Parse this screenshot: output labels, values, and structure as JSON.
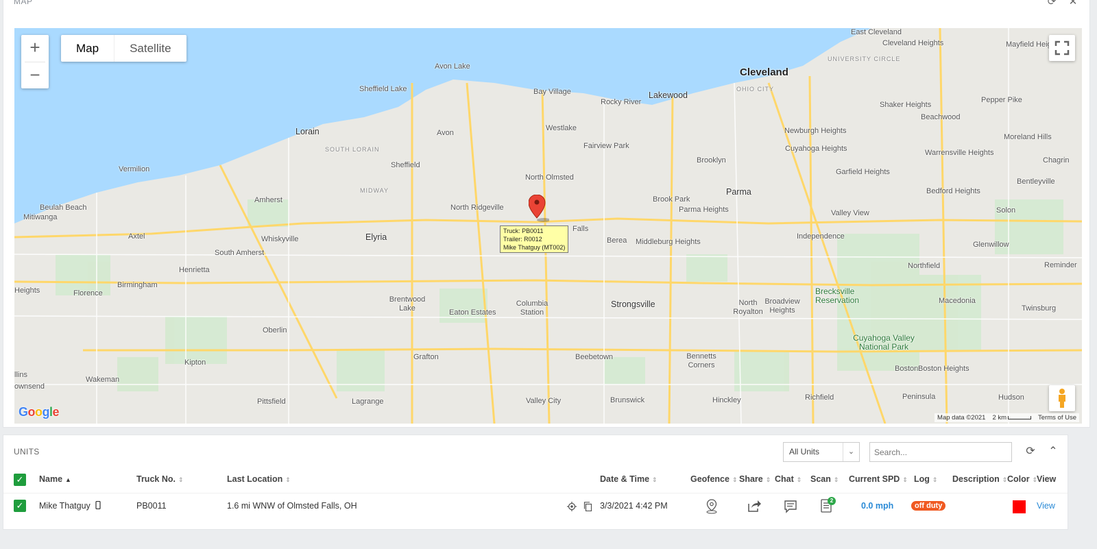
{
  "map_panel": {
    "title": "MAP",
    "refresh_icon": "refresh-icon",
    "close_icon": "close-icon",
    "controls": {
      "zoom_in": "+",
      "zoom_out": "−",
      "map_types": [
        "Map",
        "Satellite"
      ],
      "active_map_type": "Map"
    },
    "logo": "Google",
    "attribution": {
      "map_data": "Map data ©2021",
      "scale": "2 km",
      "terms": "Terms of Use"
    },
    "places": [
      {
        "name": "Cleveland",
        "size": "big"
      },
      {
        "name": "East Cleveland"
      },
      {
        "name": "Cleveland Heights"
      },
      {
        "name": "Mayfield Heights"
      },
      {
        "name": "UNIVERSITY CIRCLE",
        "size": "district"
      },
      {
        "name": "OHIO CITY",
        "size": "district"
      },
      {
        "name": "Avon Lake"
      },
      {
        "name": "Sheffield Lake"
      },
      {
        "name": "Bay Village"
      },
      {
        "name": "Rocky River"
      },
      {
        "name": "Lakewood",
        "size": "med"
      },
      {
        "name": "Shaker Heights"
      },
      {
        "name": "Pepper Pike"
      },
      {
        "name": "Lorain",
        "size": "med"
      },
      {
        "name": "Avon"
      },
      {
        "name": "Westlake"
      },
      {
        "name": "Newburgh Heights"
      },
      {
        "name": "Beachwood"
      },
      {
        "name": "SOUTH LORAIN",
        "size": "district"
      },
      {
        "name": "Fairview Park"
      },
      {
        "name": "Cuyahoga Heights"
      },
      {
        "name": "Moreland Hills"
      },
      {
        "name": "Vermilion"
      },
      {
        "name": "Sheffield"
      },
      {
        "name": "Brooklyn"
      },
      {
        "name": "Warrensville Heights"
      },
      {
        "name": "Chagrin"
      },
      {
        "name": "North Olmsted"
      },
      {
        "name": "Garfield Heights"
      },
      {
        "name": "Bentleyville"
      },
      {
        "name": "MIDWAY",
        "size": "district"
      },
      {
        "name": "Parma",
        "size": "med"
      },
      {
        "name": "Beulah Beach"
      },
      {
        "name": "Amherst"
      },
      {
        "name": "Brook Park"
      },
      {
        "name": "Bedford Heights"
      },
      {
        "name": "Mitiwanga"
      },
      {
        "name": "North Ridgeville"
      },
      {
        "name": "Parma Heights"
      },
      {
        "name": "Valley View"
      },
      {
        "name": "Solon"
      },
      {
        "name": "Falls"
      },
      {
        "name": "Axtel"
      },
      {
        "name": "Whiskyville"
      },
      {
        "name": "Elyria",
        "size": "med"
      },
      {
        "name": "Berea"
      },
      {
        "name": "Middleburg Heights"
      },
      {
        "name": "Independence"
      },
      {
        "name": "Glenwillow"
      },
      {
        "name": "South Amherst"
      },
      {
        "name": "Henrietta"
      },
      {
        "name": "Reminder"
      },
      {
        "name": "Northfield"
      },
      {
        "name": "Birmingham"
      },
      {
        "name": "Heights"
      },
      {
        "name": "Florence"
      },
      {
        "name": "Brecksville Reservation",
        "size": "park"
      },
      {
        "name": "Macedonia"
      },
      {
        "name": "Twinsburg"
      },
      {
        "name": "Brentwood Lake"
      },
      {
        "name": "Columbia Station"
      },
      {
        "name": "Strongsville",
        "size": "med"
      },
      {
        "name": "North Royalton"
      },
      {
        "name": "Broadview Heights"
      },
      {
        "name": "Eaton Estates"
      },
      {
        "name": "Oberlin"
      },
      {
        "name": "Cuyahoga Valley National Park",
        "size": "park"
      },
      {
        "name": "Grafton"
      },
      {
        "name": "Beebetown"
      },
      {
        "name": "Bennetts Corners"
      },
      {
        "name": "Kipton"
      },
      {
        "name": "llins"
      },
      {
        "name": "Wakeman"
      },
      {
        "name": "Boston"
      },
      {
        "name": "Boston Heights"
      },
      {
        "name": "ownsend"
      },
      {
        "name": "Pittsfield"
      },
      {
        "name": "Lagrange"
      },
      {
        "name": "Valley City"
      },
      {
        "name": "Brunswick"
      },
      {
        "name": "Hinckley"
      },
      {
        "name": "Richfield"
      },
      {
        "name": "Peninsula"
      },
      {
        "name": "Hudson"
      }
    ],
    "marker_tooltip": {
      "truck": "Truck: PB0011",
      "trailer": "Trailer: R0012",
      "driver": "Mike Thatguy (MT002)"
    }
  },
  "units_panel": {
    "title": "UNITS",
    "filter": {
      "selected": "All Units"
    },
    "search": {
      "placeholder": "Search...",
      "value": ""
    },
    "columns": {
      "name": "Name",
      "truck_no": "Truck No.",
      "last_location": "Last Location",
      "date_time": "Date & Time",
      "geofence": "Geofence",
      "share": "Share",
      "chat": "Chat",
      "scan": "Scan",
      "current_spd": "Current SPD",
      "log": "Log",
      "description": "Description",
      "color": "Color",
      "view": "View"
    },
    "rows": [
      {
        "name": "Mike Thatguy",
        "truck_no": "PB0011",
        "last_location": "1.6 mi WNW of Olmsted Falls, OH",
        "date_time": "3/3/2021 4:42 PM",
        "scan_count": "2",
        "current_spd": "0.0 mph",
        "log": "off duty",
        "description": "",
        "color": "#ff0000",
        "view": "View"
      }
    ]
  }
}
